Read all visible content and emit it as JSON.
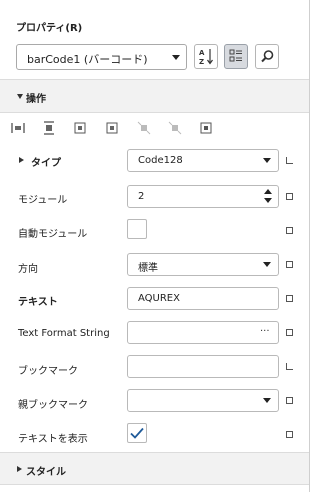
{
  "panel": {
    "title": "プロパティ(R)",
    "object_selector": {
      "value": "barCode1 (バーコード)"
    },
    "toolbar": {
      "sort_alpha_icon": "sort-alphabetical-icon",
      "categorized_icon": "categorized-view-icon",
      "search_icon": "search-icon"
    }
  },
  "sections": {
    "operations": {
      "label": "操作"
    },
    "style": {
      "label": "スタイル"
    }
  },
  "align_icons": [
    "align-left-edges-icon",
    "align-centers-icon",
    "align-middle-icon",
    "center-horizontally-icon",
    "same-width-icon",
    "same-height-icon",
    "center-in-page-icon"
  ],
  "properties": {
    "type": {
      "label": "タイプ",
      "value": "Code128"
    },
    "module": {
      "label": "モジュール",
      "value": "2"
    },
    "auto_module": {
      "label": "自動モジュール",
      "checked": false
    },
    "direction": {
      "label": "方向",
      "value": "標準"
    },
    "text": {
      "label": "テキスト",
      "value": "AQUREX"
    },
    "text_format": {
      "label": "Text Format String",
      "value": "",
      "ellipsis": "···"
    },
    "bookmark": {
      "label": "ブックマーク",
      "value": ""
    },
    "parent_bookmark": {
      "label": "親ブックマーク",
      "value": ""
    },
    "show_text": {
      "label": "テキストを表示",
      "checked": true
    }
  }
}
